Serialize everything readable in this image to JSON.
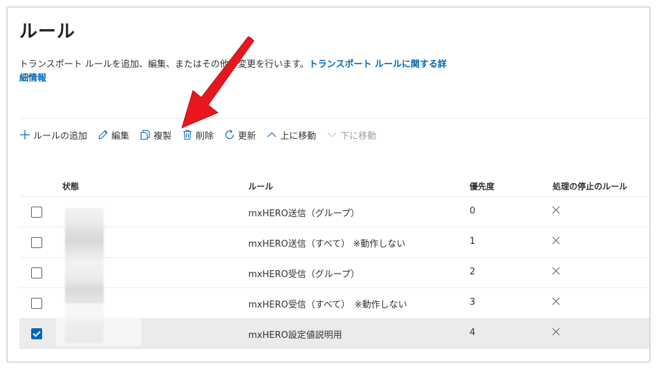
{
  "page": {
    "title": "ルール",
    "description": "トランスポート ルールを追加、編集、またはその他の変更を行います。",
    "link_text": "トランスポート ルールに関する詳細情報"
  },
  "toolbar": [
    {
      "label": "ルールの追加",
      "icon": "plus-icon",
      "disabled": false
    },
    {
      "label": "編集",
      "icon": "pencil-icon",
      "disabled": false
    },
    {
      "label": "複製",
      "icon": "copy-icon",
      "disabled": false
    },
    {
      "label": "削除",
      "icon": "trash-icon",
      "disabled": false
    },
    {
      "label": "更新",
      "icon": "refresh-icon",
      "disabled": false
    },
    {
      "label": "上に移動",
      "icon": "chevron-up-icon",
      "disabled": false
    },
    {
      "label": "下に移動",
      "icon": "chevron-down-icon",
      "disabled": true
    }
  ],
  "table": {
    "columns": [
      "状態",
      "ルール",
      "優先度",
      "処理の停止のルール"
    ],
    "rows": [
      {
        "checked": false,
        "rule": "mxHERO送信（グループ）",
        "priority": "0",
        "stop": "×"
      },
      {
        "checked": false,
        "rule": "mxHERO送信（すべて） ※動作しない",
        "priority": "1",
        "stop": "×"
      },
      {
        "checked": false,
        "rule": "mxHERO受信（グループ）",
        "priority": "2",
        "stop": "×"
      },
      {
        "checked": false,
        "rule": "mxHERO受信（すべて）　※動作しない",
        "priority": "3",
        "stop": "×"
      },
      {
        "checked": true,
        "rule": "mxHERO設定値説明用",
        "priority": "4",
        "stop": "×"
      }
    ]
  },
  "colors": {
    "accent": "#0067b8",
    "annotation_arrow": "#e8161d",
    "selected_row": "#edebe9"
  }
}
